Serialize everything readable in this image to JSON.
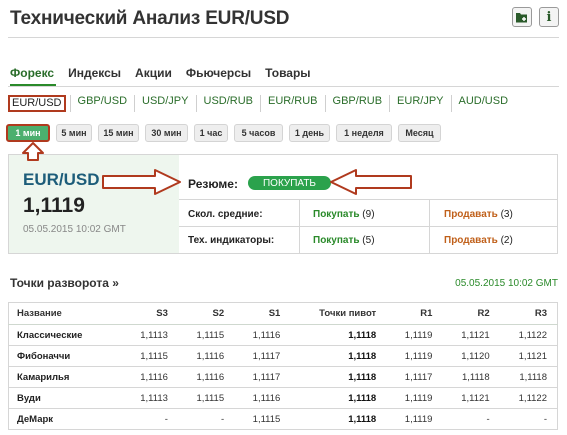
{
  "header": {
    "title": "Технический Анализ EUR/USD",
    "buttons": [
      {
        "icon": "portfolio-add-icon"
      },
      {
        "icon": "info-icon",
        "glyph": "i"
      }
    ]
  },
  "categories": [
    "Форекс",
    "Индексы",
    "Акции",
    "Фьючерсы",
    "Товары"
  ],
  "pairs": [
    "EUR/USD",
    "GBP/USD",
    "USD/JPY",
    "USD/RUB",
    "EUR/RUB",
    "GBP/RUB",
    "EUR/JPY",
    "AUD/USD"
  ],
  "periods": [
    "1 мин",
    "5 мин",
    "15 мин",
    "30 мин",
    "1 час",
    "5 часов",
    "1 день",
    "1 неделя",
    "Месяц"
  ],
  "summary": {
    "pair": "EUR/USD",
    "price": "1,1119",
    "date": "05.05.2015 10:02 GMT",
    "label": "Резюме:",
    "signal": "ПОКУПАТЬ",
    "rows": [
      {
        "label": "Скол. средние:",
        "buy": "Покупать",
        "buy_count": "(9)",
        "sell": "Продавать",
        "sell_count": "(3)"
      },
      {
        "label": "Тех. индикаторы:",
        "buy": "Покупать",
        "buy_count": "(5)",
        "sell": "Продавать",
        "sell_count": "(2)"
      }
    ]
  },
  "pivots": {
    "title": "Точки разворота »",
    "date": "05.05.2015 10:02 GMT",
    "columns": [
      "Название",
      "S3",
      "S2",
      "S1",
      "Точки пивот",
      "R1",
      "R2",
      "R3"
    ],
    "rows": [
      [
        "Классические",
        "1,1113",
        "1,1115",
        "1,1116",
        "1,1118",
        "1,1119",
        "1,1121",
        "1,1122"
      ],
      [
        "Фибоначчи",
        "1,1115",
        "1,1116",
        "1,1117",
        "1,1118",
        "1,1119",
        "1,1120",
        "1,1121"
      ],
      [
        "Камарилья",
        "1,1116",
        "1,1116",
        "1,1117",
        "1,1118",
        "1,1117",
        "1,1118",
        "1,1118"
      ],
      [
        "Вуди",
        "1,1113",
        "1,1115",
        "1,1116",
        "1,1118",
        "1,1119",
        "1,1121",
        "1,1122"
      ],
      [
        "ДеМарк",
        "-",
        "-",
        "1,1115",
        "1,1118",
        "1,1119",
        "-",
        "-"
      ]
    ]
  },
  "colors": {
    "accent_green": "#2ba24c",
    "annotation_red": "#b03a1e",
    "sell_orange": "#c0601a"
  }
}
